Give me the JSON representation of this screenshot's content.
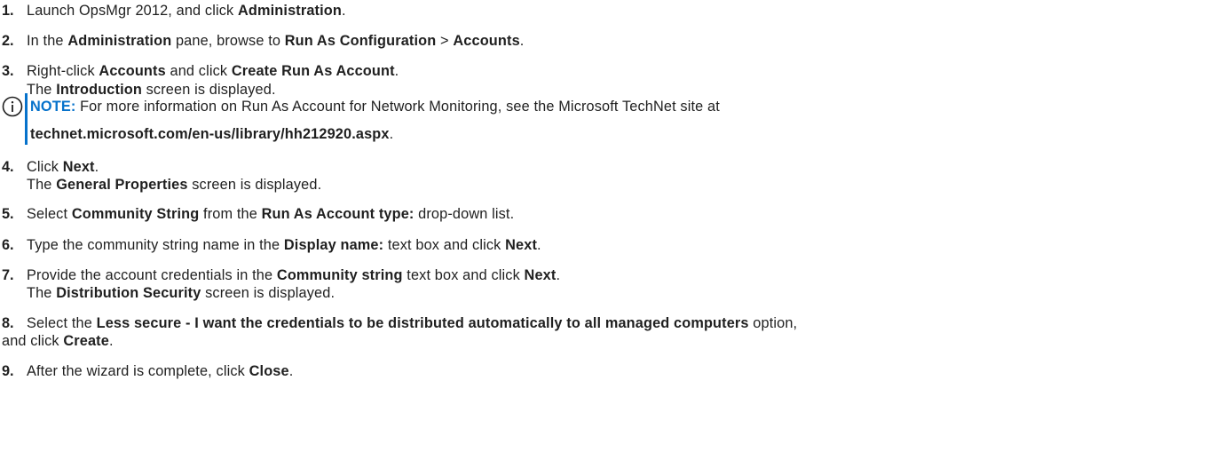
{
  "steps": [
    {
      "number": "1.",
      "parts": [
        "Launch OpsMgr 2012, and click ",
        "Administration",
        "."
      ]
    },
    {
      "number": "2.",
      "parts": [
        "In the ",
        "Administration",
        " pane, browse to ",
        "Run As Configuration",
        " > ",
        "Accounts",
        "."
      ]
    },
    {
      "number": "3.",
      "parts": [
        "Right-click ",
        "Accounts",
        " and click ",
        "Create Run As Account",
        "."
      ],
      "result_parts": [
        "The ",
        "Introduction",
        " screen is displayed."
      ],
      "note": {
        "label": "NOTE:",
        "text": " For more information on Run As Account for Network Monitoring, see the Microsoft TechNet site at",
        "link": "technet.microsoft.com/en-us/library/hh212920.aspx",
        "end": "."
      }
    },
    {
      "number": "4.",
      "parts": [
        "Click ",
        "Next",
        "."
      ],
      "result_parts": [
        "The ",
        "General Properties",
        " screen is displayed."
      ]
    },
    {
      "number": "5.",
      "parts": [
        "Select ",
        "Community String",
        " from the ",
        "Run As Account type:",
        " drop-down list."
      ]
    },
    {
      "number": "6.",
      "parts": [
        "Type the community string name in the ",
        "Display name:",
        " text box and click ",
        "Next",
        "."
      ]
    },
    {
      "number": "7.",
      "parts": [
        "Provide the account credentials in the ",
        "Community string",
        " text box and click ",
        "Next",
        "."
      ],
      "result_parts": [
        "The ",
        "Distribution Security",
        " screen is displayed."
      ]
    },
    {
      "number": "8.",
      "parts": [
        "Select the ",
        "Less secure - I want the credentials to be distributed automatically to all managed computers",
        " option,"
      ],
      "cont_parts": [
        "and click ",
        "Create",
        "."
      ]
    },
    {
      "number": "9.",
      "parts": [
        "After the wizard is complete, click ",
        "Close",
        "."
      ]
    }
  ],
  "colors": {
    "text": "#1f1f1f",
    "note_accent": "#0672cb"
  },
  "icons": {
    "note": "info-circle-icon"
  }
}
